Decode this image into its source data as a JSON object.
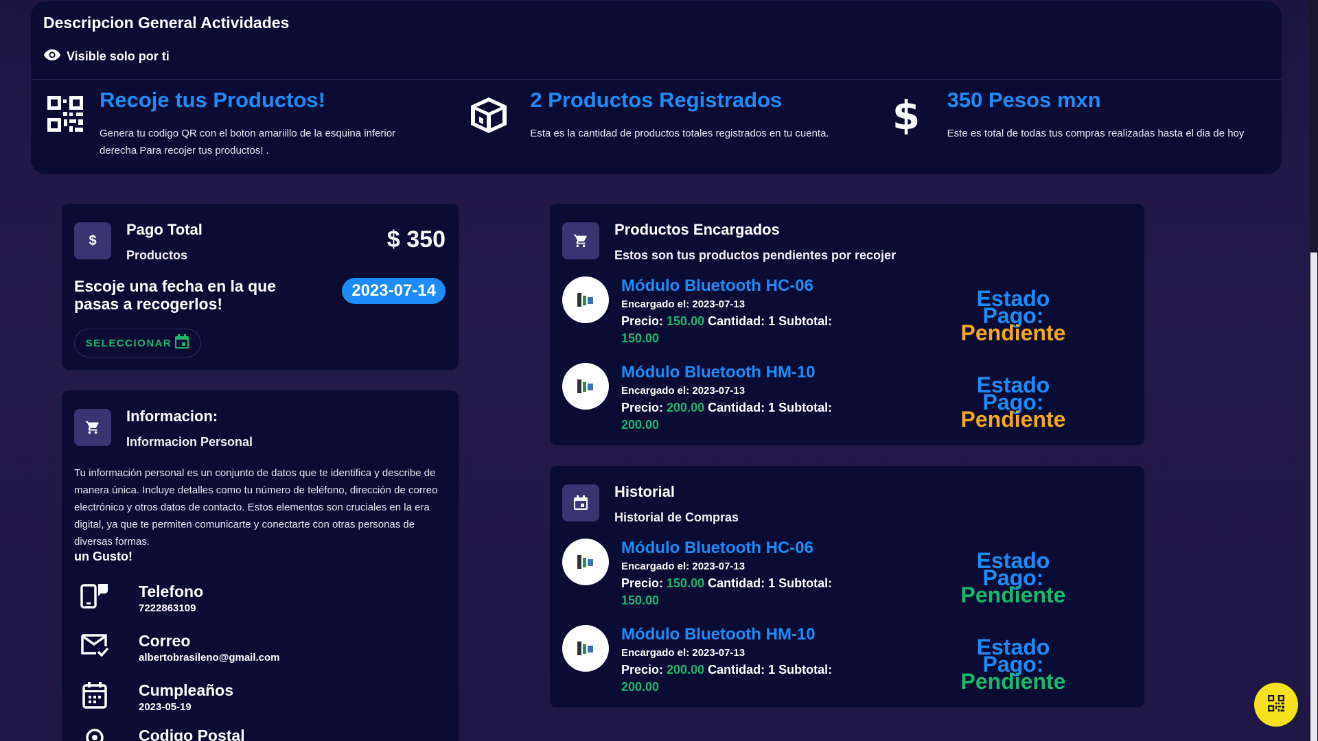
{
  "overview": {
    "title": "Descripcion General Actividades",
    "visibility": "Visible solo por ti",
    "items": [
      {
        "icon": "qr-code-icon",
        "title": "Recoje tus Productos!",
        "desc": "Genera tu codigo QR con el boton amariillo de la esquina inferior derecha Para recojer tus productos! ."
      },
      {
        "icon": "box-icon",
        "title": "2 Productos Registrados",
        "desc": "Esta es la cantidad de productos totales registrados en tu cuenta."
      },
      {
        "icon": "dollar-icon",
        "title": "350 Pesos mxn",
        "desc": "Este es total de todas tus compras realizadas hasta el dia de hoy"
      }
    ]
  },
  "payment": {
    "title": "Pago Total",
    "subtitle": "Productos",
    "amount": "$ 350",
    "question": "Escoje una fecha en la que pasas a recogerlos!",
    "date": "2023-07-14",
    "select_label": "SELECCIONAR"
  },
  "info": {
    "title": "Informacion:",
    "subtitle": "Informacion Personal",
    "text": "Tu información personal es un conjunto de datos que te identifica y describe de manera única. Incluye detalles como tu número de teléfono, dirección de correo electrónico y otros datos de contacto. Estos elementos son cruciales en la era digital, ya que te permiten comunicarte y conectarte con otras personas de diversas formas.",
    "closing": "un Gusto!",
    "contacts": [
      {
        "icon": "phone-icon",
        "title": "Telefono",
        "value": "7222863109"
      },
      {
        "icon": "mail-icon",
        "title": "Correo",
        "value": "albertobrasileno@gmail.com"
      },
      {
        "icon": "calendar-icon",
        "title": "Cumpleaños",
        "value": "2023-05-19"
      },
      {
        "icon": "location-icon",
        "title": "Codigo Postal",
        "value": ""
      }
    ]
  },
  "orders": {
    "title": "Productos Encargados",
    "subtitle": "Estos son tus productos pendientes por recojer",
    "items": [
      {
        "name": "Módulo Bluetooth HC-06",
        "date_label": "Encargado el: 2023-07-13",
        "price_label": "Precio: ",
        "price": "150.00",
        "qty_label": " Cantidad: 1 Subtotal:",
        "subtotal": "150.00",
        "status_label": "Estado Pago:",
        "status": "Pendiente"
      },
      {
        "name": "Módulo Bluetooth HM-10",
        "date_label": "Encargado el: 2023-07-13",
        "price_label": "Precio: ",
        "price": "200.00",
        "qty_label": " Cantidad: 1 Subtotal:",
        "subtotal": "200.00",
        "status_label": "Estado Pago:",
        "status": "Pendiente"
      }
    ]
  },
  "history": {
    "title": "Historial",
    "subtitle": "Historial de Compras",
    "items": [
      {
        "name": "Módulo Bluetooth HC-06",
        "date_label": "Encargado el: 2023-07-13",
        "price_label": "Precio: ",
        "price": "150.00",
        "qty_label": " Cantidad: 1 Subtotal:",
        "subtotal": "150.00",
        "status_label": "Estado Pago:",
        "status": "Pendiente"
      },
      {
        "name": "Módulo Bluetooth HM-10",
        "date_label": "Encargado el: 2023-07-13",
        "price_label": "Precio: ",
        "price": "200.00",
        "qty_label": " Cantidad: 1 Subtotal:",
        "subtotal": "200.00",
        "status_label": "Estado Pago:",
        "status": "Pendiente"
      }
    ]
  },
  "colors": {
    "accent": "#1d8cf8",
    "success": "#19b86a",
    "warning": "#f5a623",
    "fab": "#f8e21b"
  }
}
